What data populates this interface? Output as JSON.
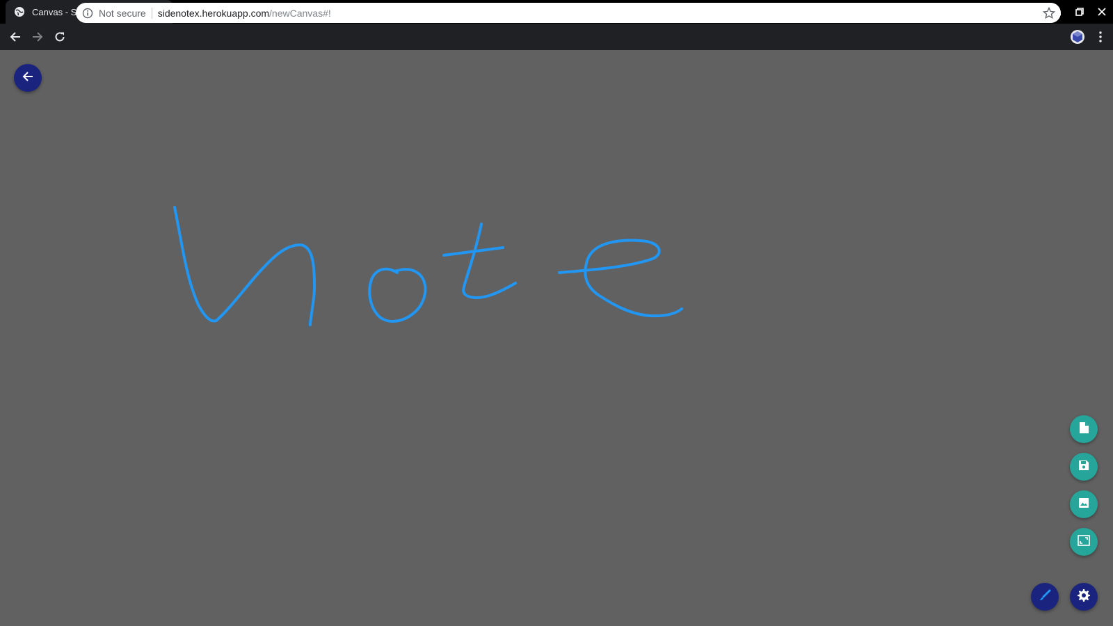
{
  "browser": {
    "tab_title": "Canvas - Sidenote",
    "url_security": "Not secure",
    "url_host": "sidenotex.herokuapp.com",
    "url_path": "/newCanvas#!",
    "icons": {
      "favicon": "globe-icon",
      "tab_close": "close-icon",
      "new_tab": "plus-icon",
      "back": "arrow-back-icon",
      "forward": "arrow-forward-icon",
      "reload": "reload-icon",
      "info": "info-icon",
      "bookmark": "star-icon",
      "extension": "extension-icon",
      "menu": "kebab-menu-icon"
    }
  },
  "canvas": {
    "background": "#616161",
    "stroke_color": "#2196f3",
    "handwriting_text": "note"
  },
  "actions": {
    "back": "arrow-back-icon",
    "side": [
      "new-file-icon",
      "save-icon",
      "image-icon",
      "fullscreen-icon"
    ],
    "bottom": [
      "brush-icon",
      "settings-icon"
    ]
  },
  "colors": {
    "fab_primary": "#1a237e",
    "fab_secondary": "#26a69a"
  }
}
